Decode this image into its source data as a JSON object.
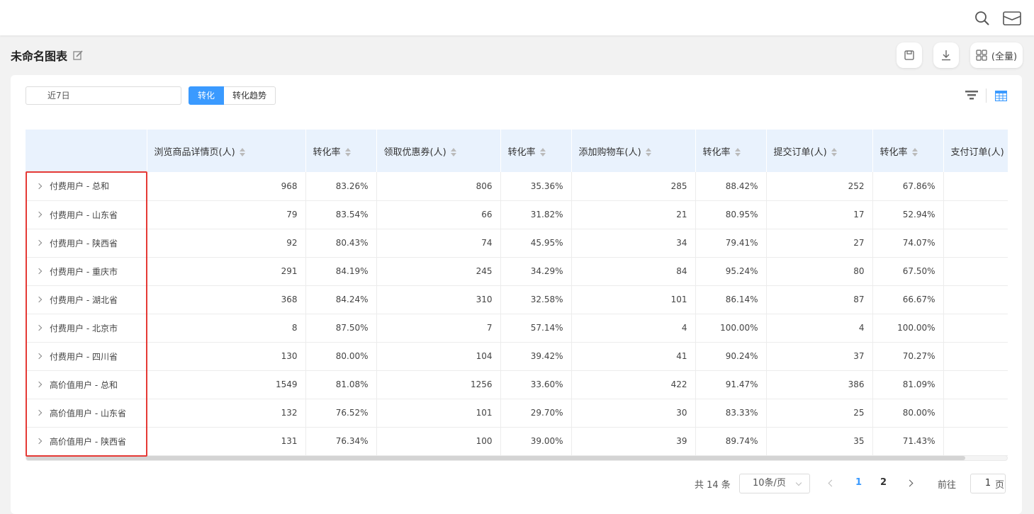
{
  "header": {
    "icons": [
      "search-icon",
      "mail-icon"
    ]
  },
  "page": {
    "title": "未命名图表"
  },
  "actions": {
    "full_label": "(全量)"
  },
  "filters": {
    "date_range": "近7日",
    "tabs": [
      {
        "label": "转化",
        "active": true
      },
      {
        "label": "转化趋势",
        "active": false
      }
    ]
  },
  "table": {
    "columns": [
      "",
      "浏览商品详情页(人)",
      "转化率",
      "领取优惠券(人)",
      "转化率",
      "添加购物车(人)",
      "转化率",
      "提交订单(人)",
      "转化率",
      "支付订单(人)"
    ],
    "rows": [
      {
        "label": "付费用户 - 总和",
        "cells": [
          "968",
          "83.26%",
          "806",
          "35.36%",
          "285",
          "88.42%",
          "252",
          "67.86%",
          ""
        ]
      },
      {
        "label": "付费用户 - 山东省",
        "cells": [
          "79",
          "83.54%",
          "66",
          "31.82%",
          "21",
          "80.95%",
          "17",
          "52.94%",
          ""
        ]
      },
      {
        "label": "付费用户 - 陕西省",
        "cells": [
          "92",
          "80.43%",
          "74",
          "45.95%",
          "34",
          "79.41%",
          "27",
          "74.07%",
          ""
        ]
      },
      {
        "label": "付费用户 - 重庆市",
        "cells": [
          "291",
          "84.19%",
          "245",
          "34.29%",
          "84",
          "95.24%",
          "80",
          "67.50%",
          ""
        ]
      },
      {
        "label": "付费用户 - 湖北省",
        "cells": [
          "368",
          "84.24%",
          "310",
          "32.58%",
          "101",
          "86.14%",
          "87",
          "66.67%",
          ""
        ]
      },
      {
        "label": "付费用户 - 北京市",
        "cells": [
          "8",
          "87.50%",
          "7",
          "57.14%",
          "4",
          "100.00%",
          "4",
          "100.00%",
          ""
        ]
      },
      {
        "label": "付费用户 - 四川省",
        "cells": [
          "130",
          "80.00%",
          "104",
          "39.42%",
          "41",
          "90.24%",
          "37",
          "70.27%",
          ""
        ]
      },
      {
        "label": "高价值用户 - 总和",
        "cells": [
          "1549",
          "81.08%",
          "1256",
          "33.60%",
          "422",
          "91.47%",
          "386",
          "81.09%",
          ""
        ]
      },
      {
        "label": "高价值用户 - 山东省",
        "cells": [
          "132",
          "76.52%",
          "101",
          "29.70%",
          "30",
          "83.33%",
          "25",
          "80.00%",
          ""
        ]
      },
      {
        "label": "高价值用户 - 陕西省",
        "cells": [
          "131",
          "76.34%",
          "100",
          "39.00%",
          "39",
          "89.74%",
          "35",
          "71.43%",
          ""
        ]
      }
    ]
  },
  "pagination": {
    "total": "共 14 条",
    "page_size": "10条/页",
    "pages": [
      "1",
      "2"
    ],
    "current": "1",
    "goto_prefix": "前往",
    "goto_value": "1",
    "goto_suffix": "页"
  },
  "colors": {
    "accent": "#3a9aff",
    "highlight": "#e53935",
    "header_bg": "#e9f2fd"
  }
}
